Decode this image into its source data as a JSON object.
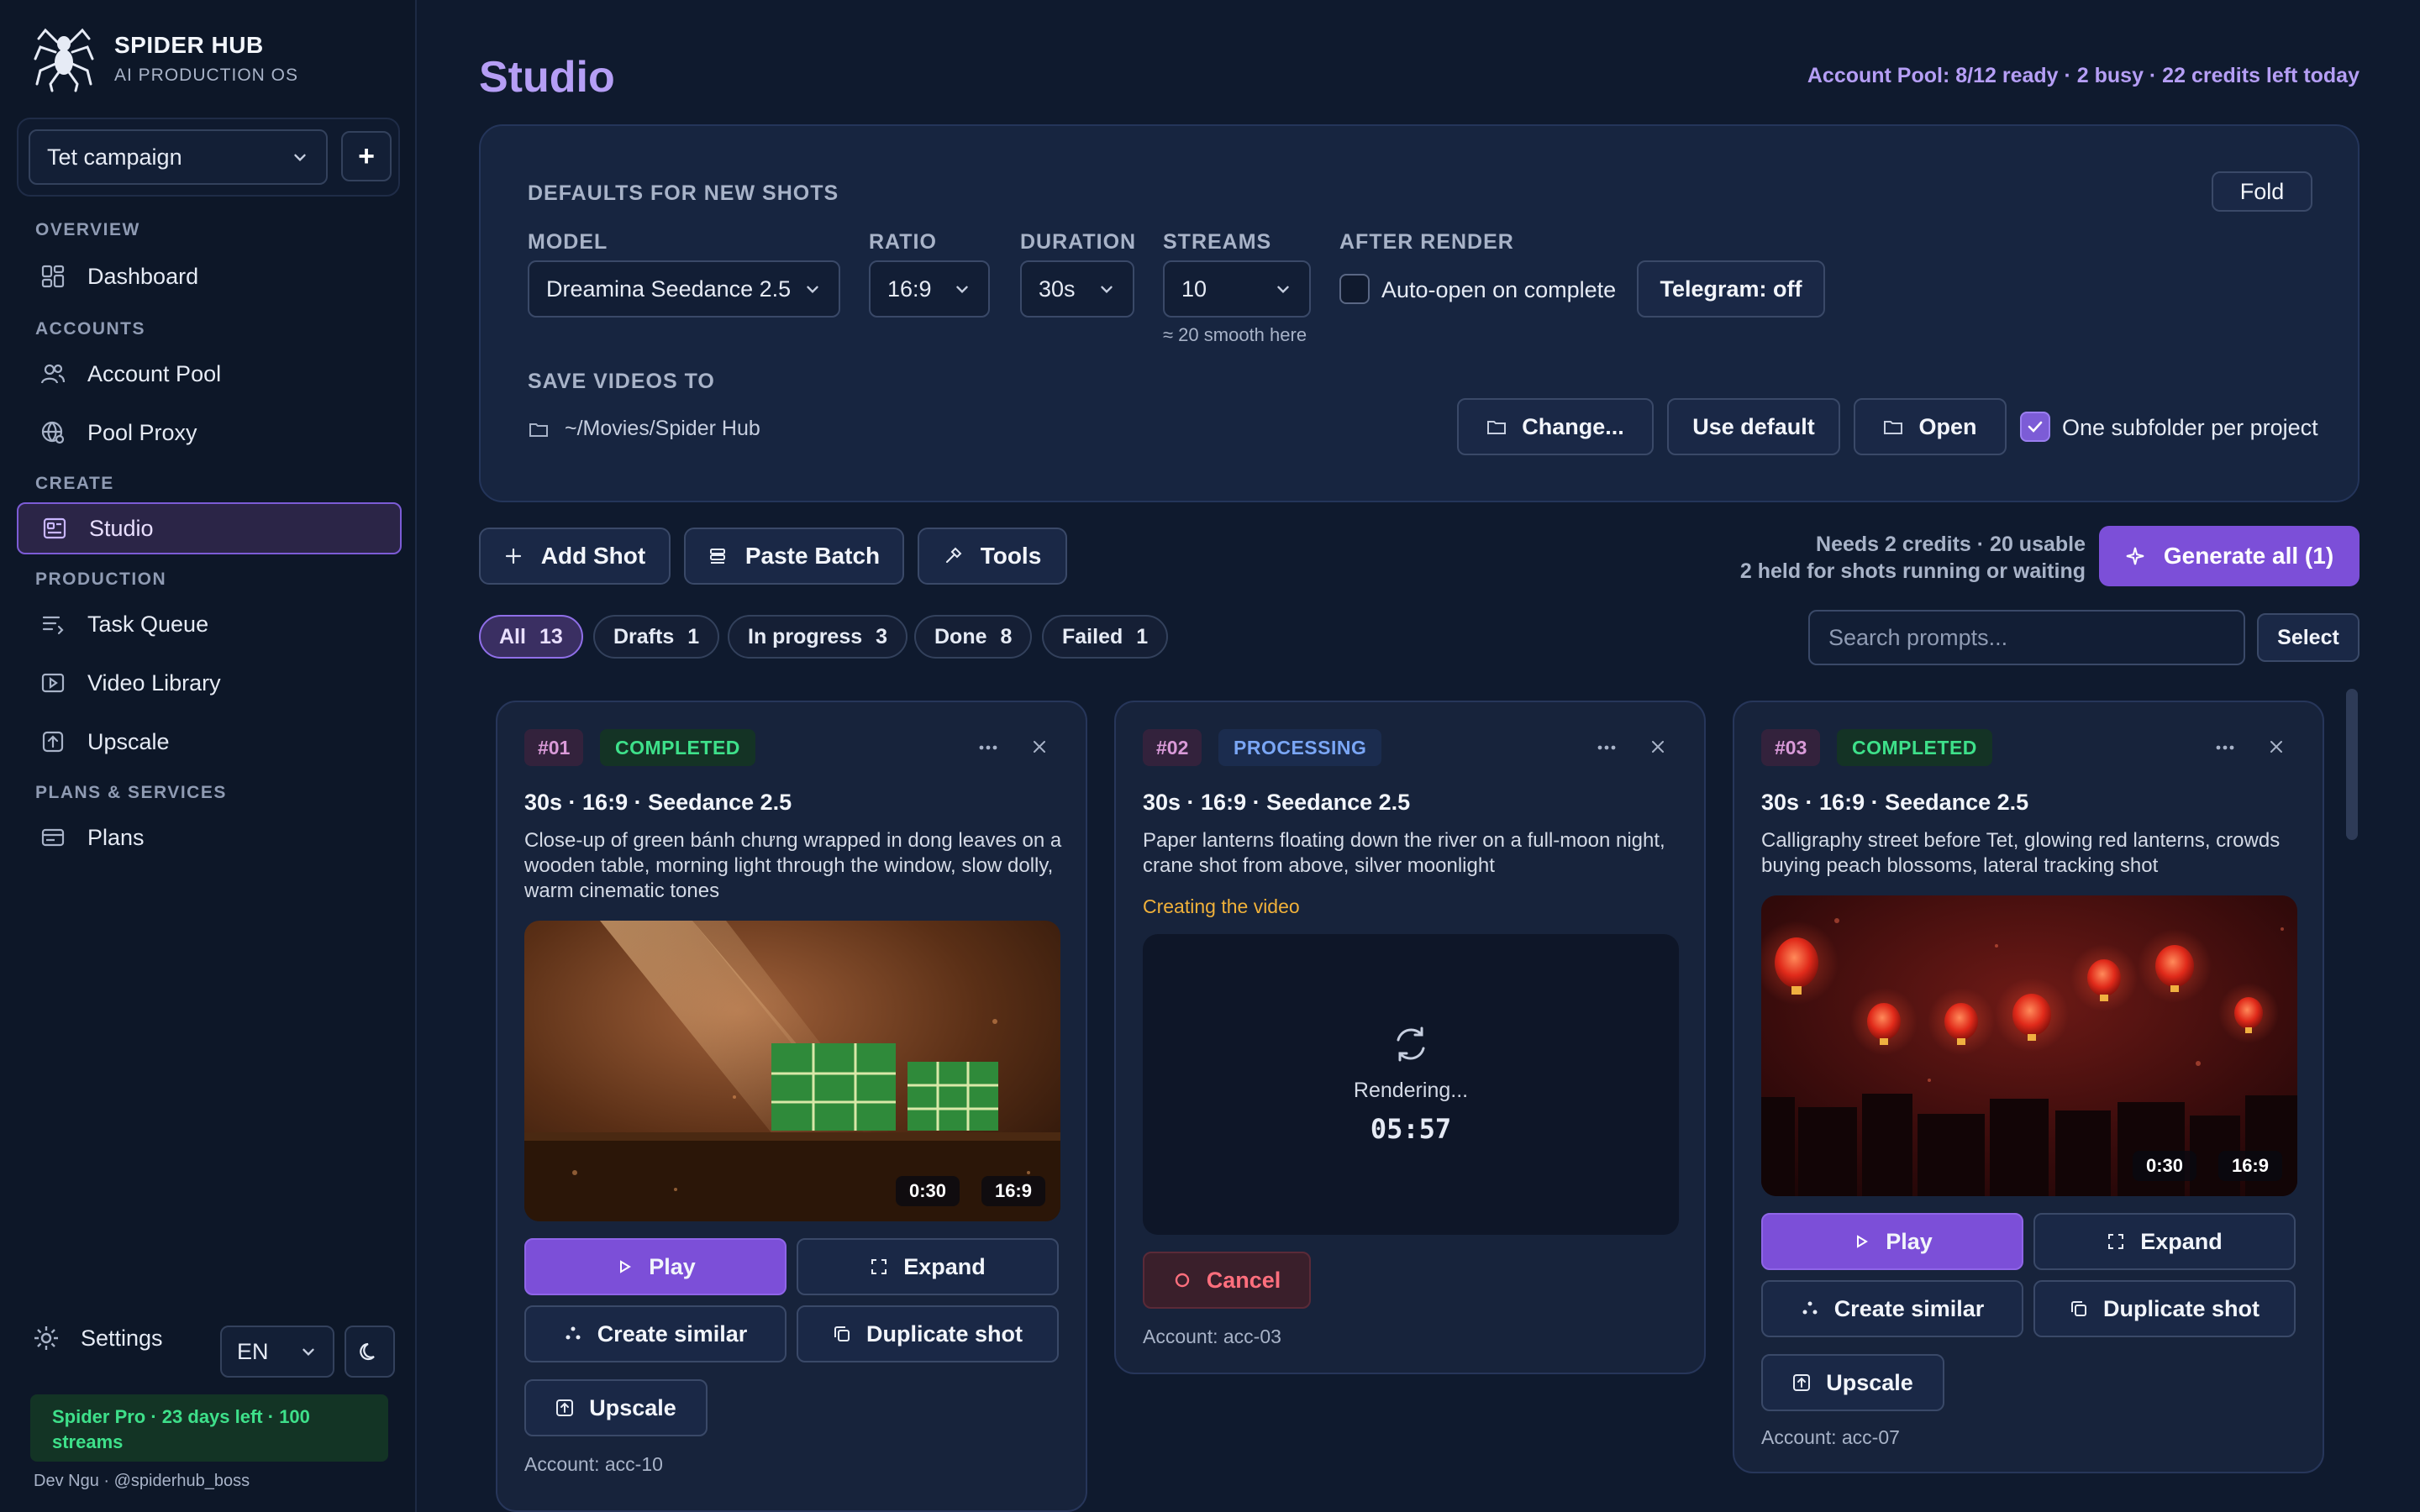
{
  "brand": {
    "name": "SPIDER HUB",
    "subtitle": "AI PRODUCTION OS"
  },
  "project": {
    "selected": "Tet campaign",
    "add_label": "+"
  },
  "nav": {
    "groups": [
      {
        "label": "OVERVIEW",
        "items": [
          {
            "label": "Dashboard",
            "icon": "dashboard-icon"
          }
        ]
      },
      {
        "label": "ACCOUNTS",
        "items": [
          {
            "label": "Account Pool",
            "icon": "users-icon"
          },
          {
            "label": "Pool Proxy",
            "icon": "globe-icon"
          }
        ]
      },
      {
        "label": "CREATE",
        "items": [
          {
            "label": "Studio",
            "icon": "studio-icon",
            "active": true
          }
        ]
      },
      {
        "label": "PRODUCTION",
        "items": [
          {
            "label": "Task Queue",
            "icon": "list-icon"
          },
          {
            "label": "Video Library",
            "icon": "video-icon"
          },
          {
            "label": "Upscale",
            "icon": "upscale-icon"
          }
        ]
      },
      {
        "label": "PLANS & SERVICES",
        "items": [
          {
            "label": "Plans",
            "icon": "card-icon"
          }
        ]
      }
    ]
  },
  "footer": {
    "settings_label": "Settings",
    "language": "EN",
    "plan_badge": "Spider Pro · 23 days left · 100 streams",
    "user": "Dev Ngu · @spiderhub_boss"
  },
  "header": {
    "title": "Studio",
    "pool_status": "Account Pool: 8/12 ready · 2 busy · 22 credits left today"
  },
  "defaults": {
    "title": "DEFAULTS FOR NEW SHOTS",
    "fold_label": "Fold",
    "model_label": "MODEL",
    "model_value": "Dreamina Seedance 2.5",
    "ratio_label": "RATIO",
    "ratio_value": "16:9",
    "duration_label": "DURATION",
    "duration_value": "30s",
    "streams_label": "STREAMS",
    "streams_value": "10",
    "streams_hint": "≈ 20 smooth here",
    "after_label": "AFTER RENDER",
    "auto_open_label": "Auto-open on complete",
    "telegram_label": "Telegram: off",
    "save_label": "SAVE VIDEOS TO",
    "save_path": "~/Movies/Spider Hub",
    "change_label": "Change...",
    "use_default_label": "Use default",
    "open_label": "Open",
    "subfolder_label": "One subfolder per project"
  },
  "toolbar": {
    "add_shot": "Add Shot",
    "paste_batch": "Paste Batch",
    "tools": "Tools",
    "credits_line1": "Needs 2 credits · 20 usable",
    "credits_line2": "2 held for shots running or waiting",
    "generate_all": "Generate all (1)"
  },
  "filters": [
    {
      "label": "All",
      "count": "13",
      "active": true
    },
    {
      "label": "Drafts",
      "count": "1"
    },
    {
      "label": "In progress",
      "count": "3"
    },
    {
      "label": "Done",
      "count": "8"
    },
    {
      "label": "Failed",
      "count": "1"
    }
  ],
  "search": {
    "placeholder": "Search prompts...",
    "select_label": "Select"
  },
  "cards": [
    {
      "id": "#01",
      "status": "COMPLETED",
      "meta": "30s · 16:9 · Seedance 2.5",
      "prompt": "Close-up of green bánh chưng wrapped in dong leaves on a wooden table, morning light through the window, slow dolly, warm cinematic tones",
      "duration_badge": "0:30",
      "ratio_badge": "16:9",
      "play": "Play",
      "expand": "Expand",
      "create_similar": "Create similar",
      "duplicate": "Duplicate shot",
      "upscale": "Upscale",
      "account": "Account: acc-10"
    },
    {
      "id": "#02",
      "status": "PROCESSING",
      "meta": "30s · 16:9 · Seedance 2.5",
      "prompt": "Paper lanterns floating down the river on a full-moon night, crane shot from above, silver moonlight",
      "sub_status": "Creating the video",
      "render_text": "Rendering...",
      "render_time": "05:57",
      "cancel": "Cancel",
      "account": "Account: acc-03"
    },
    {
      "id": "#03",
      "status": "COMPLETED",
      "meta": "30s · 16:9 · Seedance 2.5",
      "prompt": "Calligraphy street before Tet, glowing red lanterns, crowds buying peach blossoms, lateral tracking shot",
      "duration_badge": "0:30",
      "ratio_badge": "16:9",
      "play": "Play",
      "expand": "Expand",
      "create_similar": "Create similar",
      "duplicate": "Duplicate shot",
      "upscale": "Upscale",
      "account": "Account: acc-07"
    }
  ],
  "colors": {
    "accent": "#7c4fd8",
    "success": "#3ee08a",
    "processing": "#7aa6f5",
    "warning": "#f0b13a",
    "danger": "#ff6f7d"
  }
}
